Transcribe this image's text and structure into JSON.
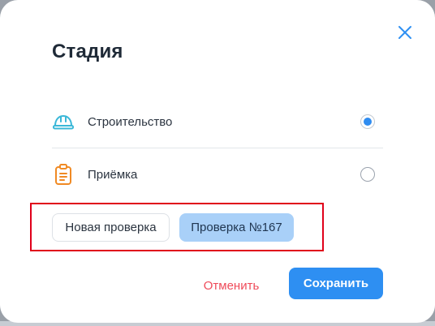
{
  "dialog": {
    "title": "Стадия",
    "close_icon": "close-icon"
  },
  "options": [
    {
      "label": "Строительство",
      "icon": "hard-hat-icon",
      "icon_color": "#3bb8d8",
      "selected": true
    },
    {
      "label": "Приёмка",
      "icon": "clipboard-icon",
      "icon_color": "#f08a24",
      "selected": false
    }
  ],
  "inspections": {
    "new_label": "Новая проверка",
    "selected_label": "Проверка №167"
  },
  "actions": {
    "cancel_label": "Отменить",
    "save_label": "Сохранить"
  },
  "colors": {
    "accent": "#2e8ff2",
    "danger": "#ef4b5a",
    "highlight_border": "#e0001a",
    "chip_selected_bg": "#a9d0f8"
  }
}
